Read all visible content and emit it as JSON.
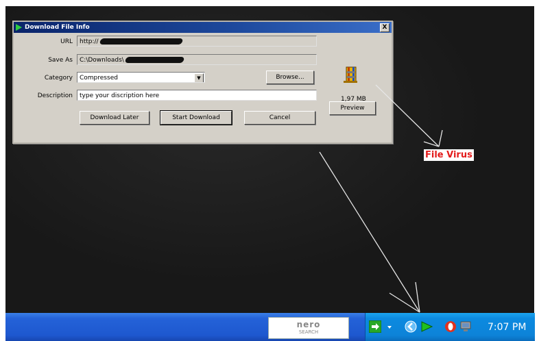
{
  "dialog": {
    "title": "Download File Info",
    "close_label": "X",
    "url_label": "URL",
    "url_value": "http://",
    "save_as_label": "Save As",
    "save_as_value": "C:\\Downloads\\",
    "category_label": "Category",
    "category_value": "Compressed",
    "description_label": "Description",
    "description_value": "type your discription here",
    "browse_label": "Browse...",
    "file_size": "1,97 MB",
    "preview_label": "Preview",
    "download_later_label": "Download Later",
    "start_download_label": "Start Download",
    "cancel_label": "Cancel"
  },
  "annotation": {
    "label": "File Virus",
    "color": "#e31b1b"
  },
  "taskbar": {
    "nero_brand": "nero",
    "nero_sub": "SEARCH",
    "clock": "7:07 PM",
    "tray_icons": [
      "network-arrow-icon",
      "chevron-left-icon",
      "flashget-icon",
      "opera-icon",
      "monitor-icon"
    ]
  }
}
